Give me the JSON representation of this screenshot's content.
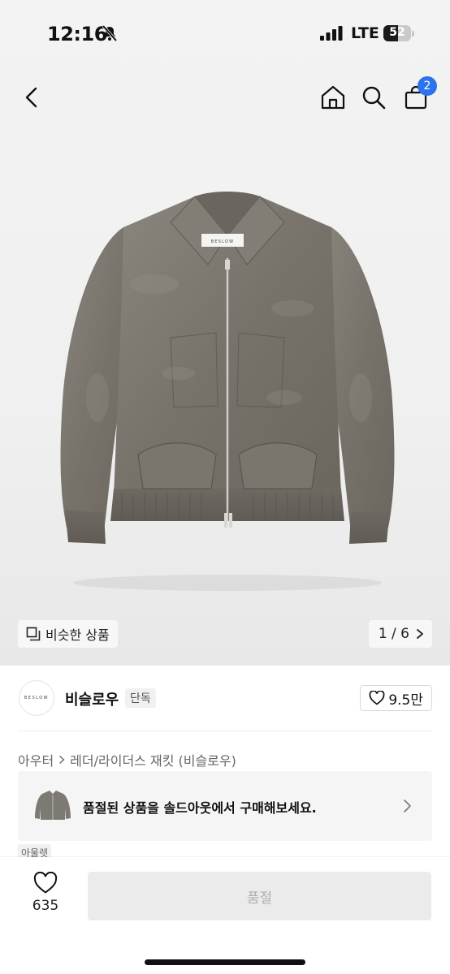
{
  "status_bar": {
    "time": "12:16",
    "network": "LTE",
    "battery": "52",
    "battery_level": 0.52
  },
  "nav": {
    "cart_count": "2"
  },
  "gallery": {
    "similar_label": "비슷한 상품",
    "pager": "1 / 6",
    "brand_label_on_jacket": "BESLOW"
  },
  "brand": {
    "logo_text": "BESLOW",
    "name": "비슬로우",
    "tag": "단독",
    "likes": "9.5만"
  },
  "breadcrumb": {
    "category": "아우터",
    "subcategory": "레더/라이더스 재킷 (비슬로우)"
  },
  "banner": {
    "text": "품절된 상품을 솔드아웃에서 구매해보세요."
  },
  "outlet_tag": "아울렛",
  "bottom": {
    "wish_count": "635",
    "buy_label": "품절"
  },
  "colors": {
    "accent": "#2d73ec",
    "jacket": "#7d7a73",
    "disabled_bg": "#ebebeb",
    "disabled_text": "#b0b0b0"
  },
  "icons": [
    "bell-slash-icon",
    "signal-icon",
    "battery-icon",
    "back-arrow-icon",
    "home-icon",
    "search-icon",
    "cart-icon",
    "similar-icon",
    "chevron-right-icon",
    "heart-icon"
  ]
}
